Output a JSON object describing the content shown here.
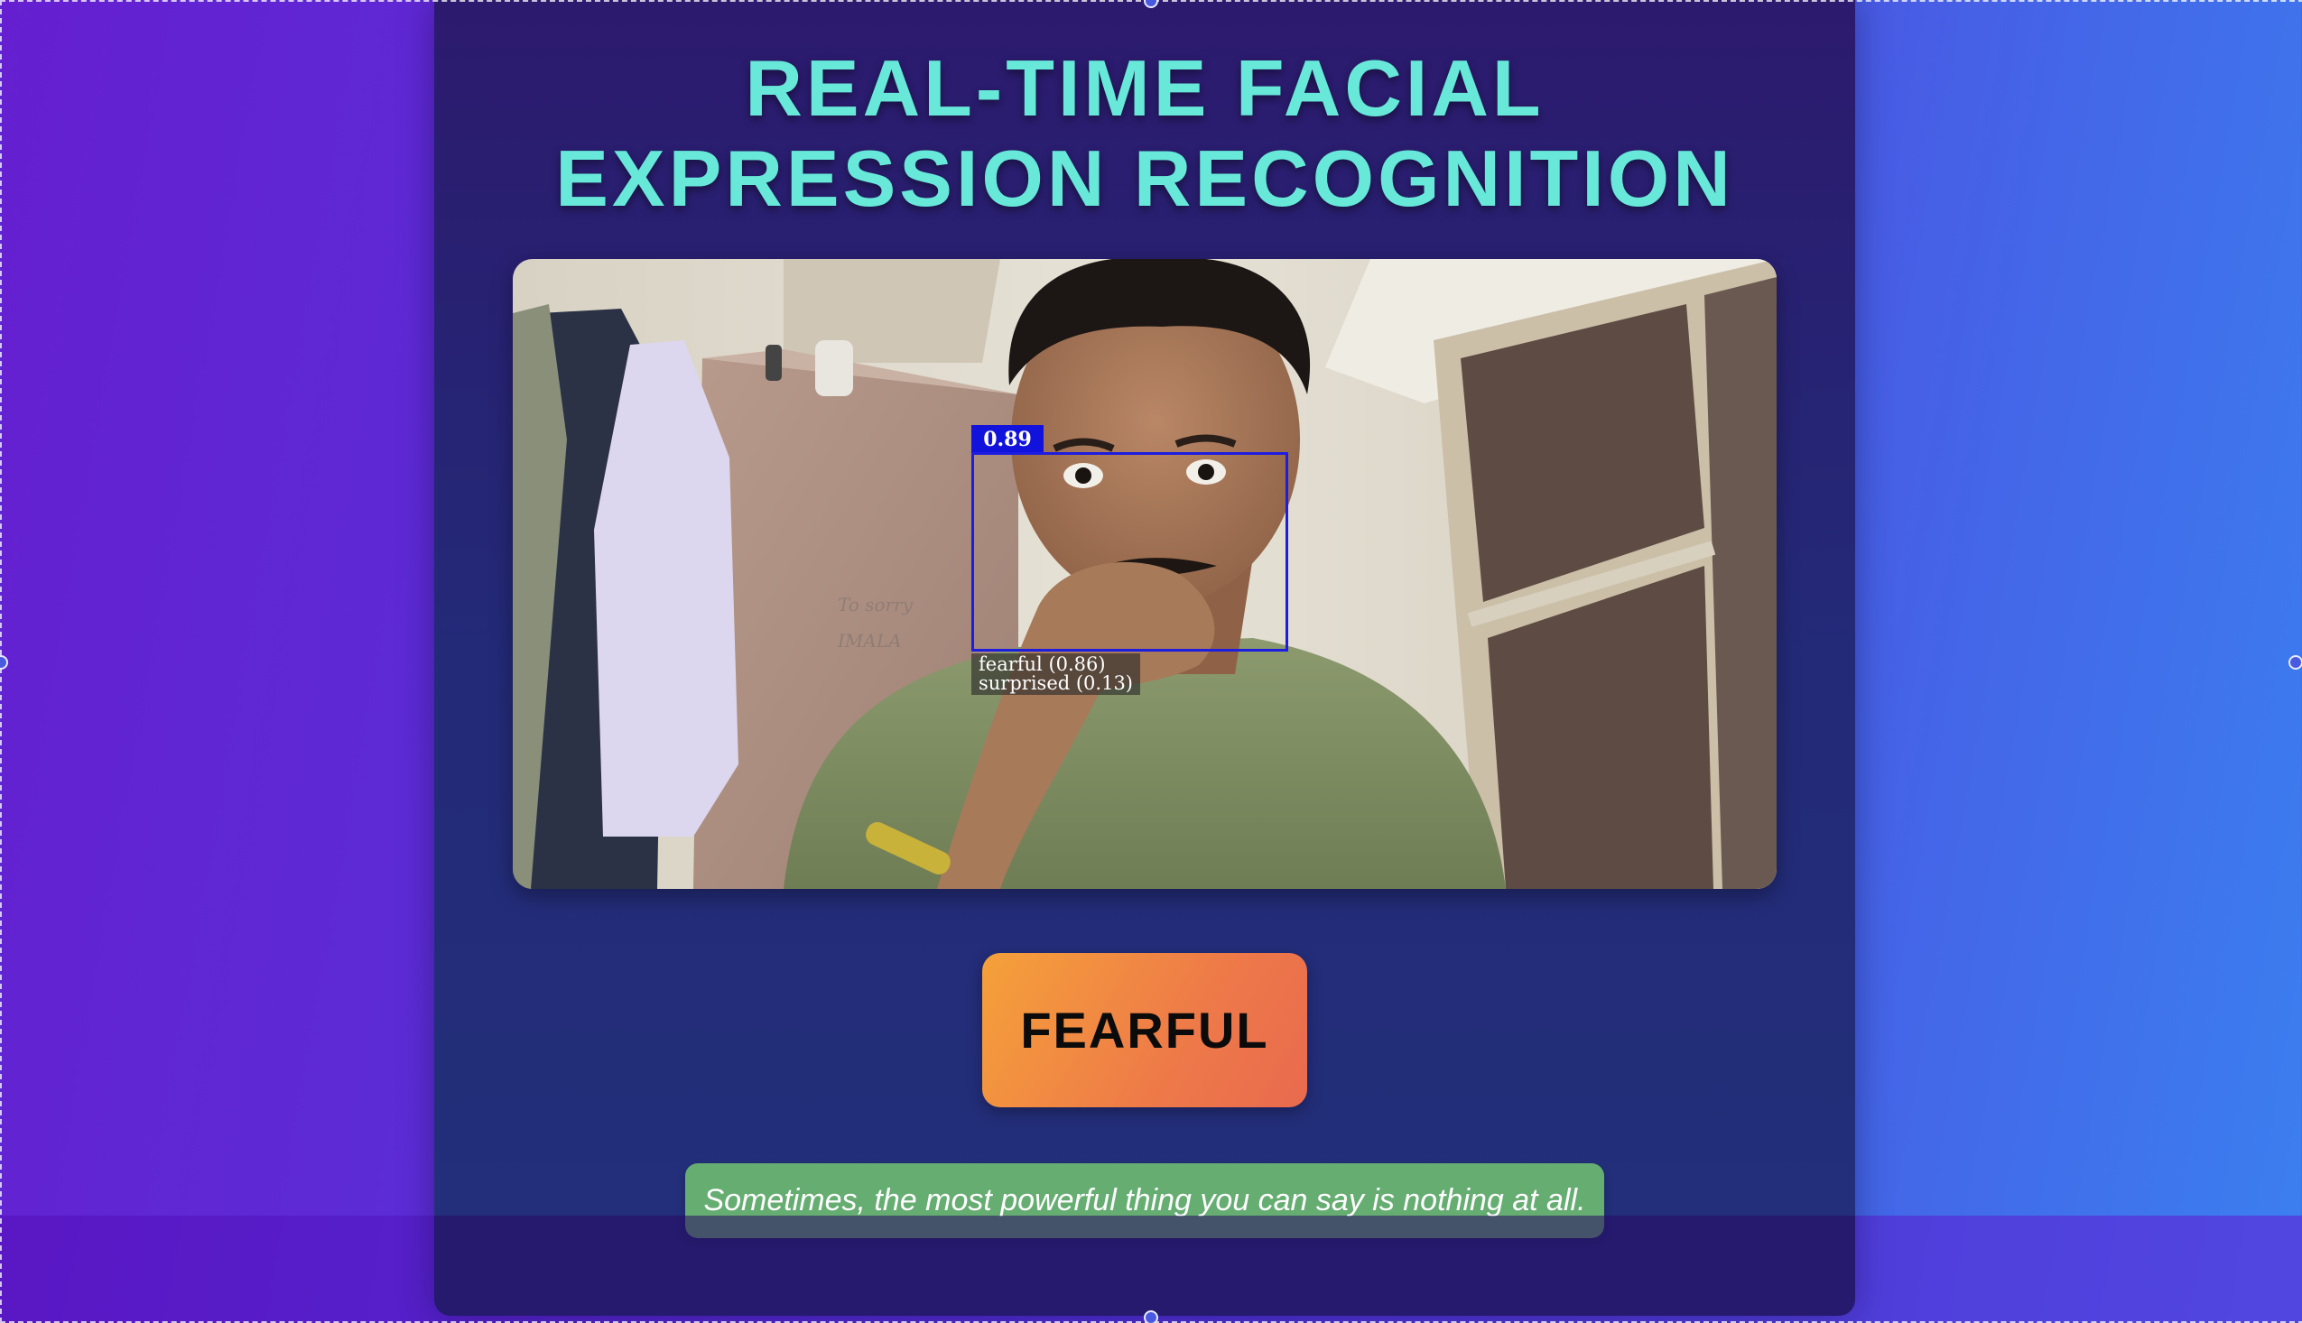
{
  "title": {
    "line1": "REAL-TIME FACIAL",
    "line2": "EXPRESSION RECOGNITION"
  },
  "video": {
    "image_description": "webcam-feed",
    "detection": {
      "score": "0.89",
      "expressions": [
        "fearful (0.86)",
        "surprised (0.13)"
      ]
    },
    "wall_writing": "To sorry / IMALA"
  },
  "emotion": {
    "label": "FEARFUL"
  },
  "quote": {
    "text": "Sometimes, the most powerful thing you can say is nothing at all."
  },
  "colors": {
    "title": "#67e8d9",
    "badge_start": "#f5a13a",
    "badge_end": "#e96a4f",
    "quote_bg": "#66ad72",
    "detection_box": "#1d1de0"
  }
}
